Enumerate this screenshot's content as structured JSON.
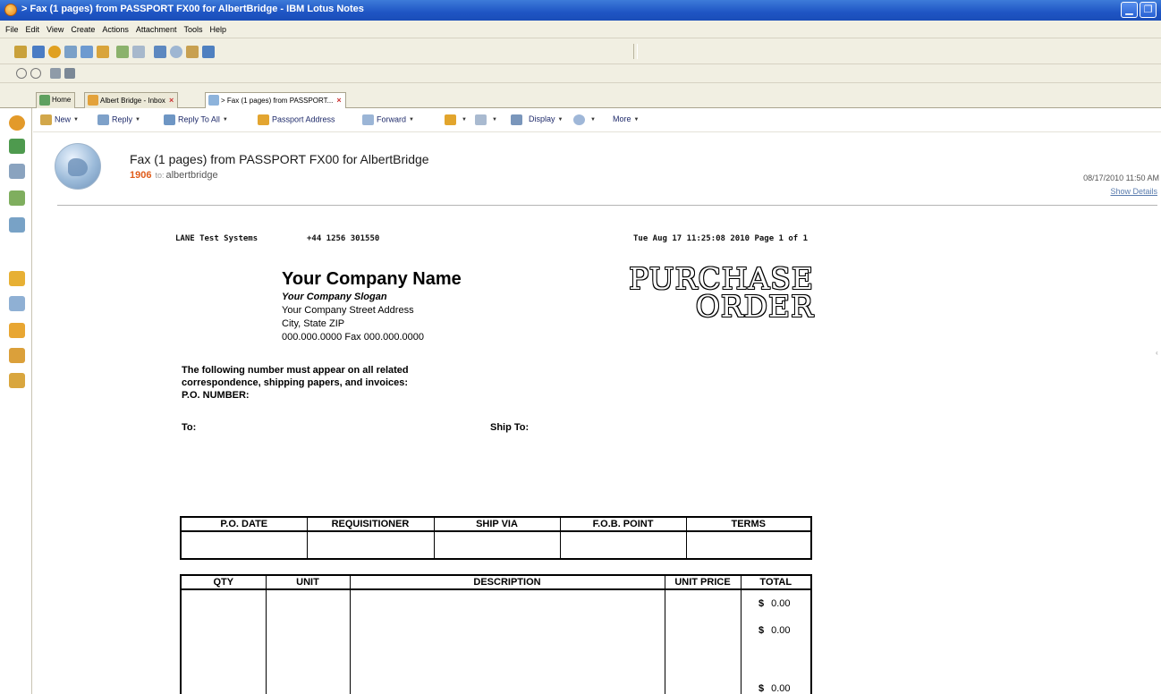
{
  "window": {
    "title": "> Fax (1 pages) from PASSPORT FX00 for AlbertBridge - IBM Lotus Notes",
    "minimize_glyph": "▁",
    "restore_glyph": "❐"
  },
  "menu": [
    "File",
    "Edit",
    "View",
    "Create",
    "Actions",
    "Attachment",
    "Tools",
    "Help"
  ],
  "tabs": [
    {
      "label": "Home",
      "close": ""
    },
    {
      "label": "Albert Bridge - Inbox",
      "close": "×"
    },
    {
      "label": "> Fax (1 pages) from PASSPORT...",
      "close": "×"
    }
  ],
  "actions": [
    {
      "label": "New",
      "caret": "▼"
    },
    {
      "label": "Reply",
      "caret": "▼"
    },
    {
      "label": "Reply To All",
      "caret": "▼"
    },
    {
      "label": "Passport Address",
      "caret": ""
    },
    {
      "label": "Forward",
      "caret": "▼"
    },
    {
      "label": "",
      "caret": "▼"
    },
    {
      "label": "",
      "caret": "▼"
    },
    {
      "label": "Display",
      "caret": "▼"
    },
    {
      "label": "",
      "caret": "▼"
    },
    {
      "label": "More",
      "caret": "▼"
    }
  ],
  "message": {
    "subject": "Fax (1 pages) from PASSPORT FX00 for AlbertBridge",
    "from_number": "1906",
    "to_label": "to:",
    "recipient": "albertbridge",
    "datetime": "08/17/2010 11:50 AM",
    "show_details": "Show Details"
  },
  "fax": {
    "sender": "LANE Test Systems",
    "phone": "+44 1256 301550",
    "stamp": "Tue Aug 17 11:25:08 2010 Page 1 of 1",
    "company_name": "Your Company Name",
    "slogan": "Your Company Slogan",
    "street": "Your Company Street Address",
    "city": "City, State  ZIP",
    "phones": "000.000.0000 Fax 000.000.0000",
    "doc_title_1": "PURCHASE",
    "doc_title_2": "ORDER",
    "notice_1": "The following number must appear on all related",
    "notice_2": "correspondence, shipping papers, and invoices:",
    "po_number_label": "P.O. NUMBER:",
    "to_label": "To:",
    "ship_to_label": "Ship To:",
    "order_headers": [
      "P.O. DATE",
      "REQUISITIONER",
      "SHIP VIA",
      "F.O.B. POINT",
      "TERMS"
    ],
    "item_headers": [
      "QTY",
      "UNIT",
      "DESCRIPTION",
      "UNIT PRICE",
      "TOTAL"
    ],
    "totals": [
      {
        "currency": "$",
        "amount": "0.00"
      },
      {
        "currency": "$",
        "amount": "0.00"
      },
      {
        "currency": "$",
        "amount": "0.00"
      }
    ]
  }
}
